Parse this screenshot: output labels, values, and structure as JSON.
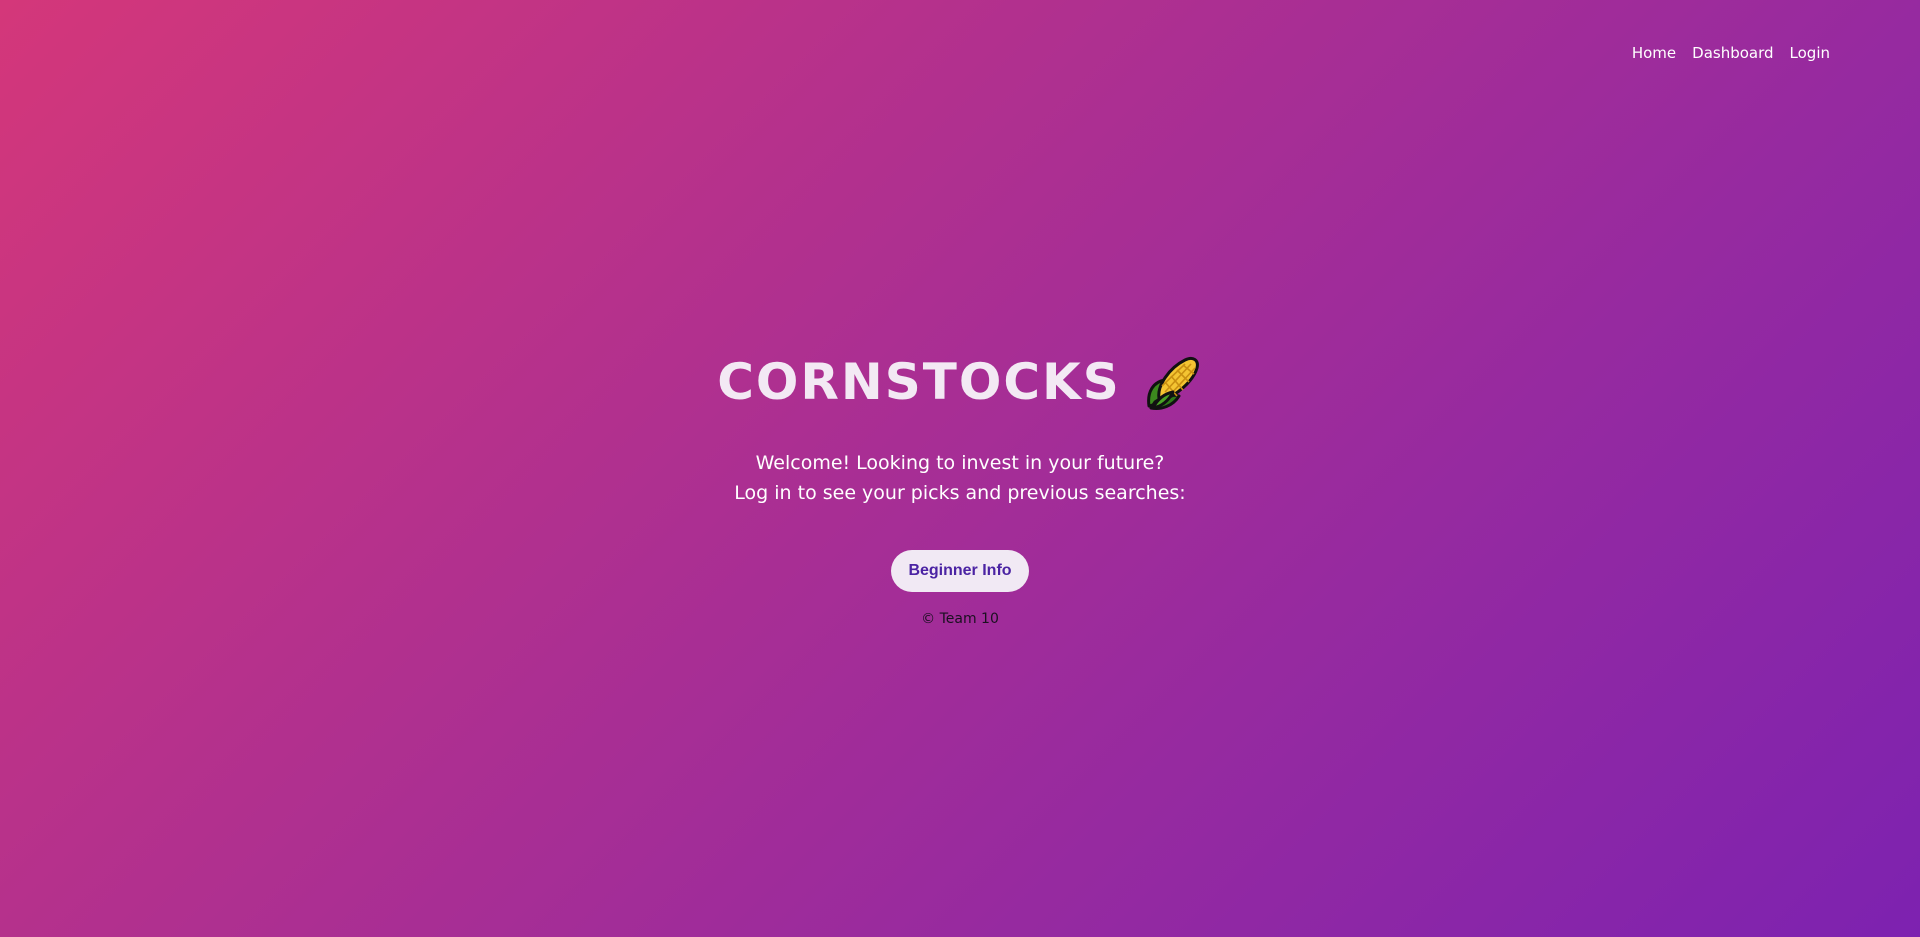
{
  "nav": {
    "items": [
      {
        "label": "Home"
      },
      {
        "label": "Dashboard"
      },
      {
        "label": "Login"
      }
    ]
  },
  "hero": {
    "title": "CORNSTOCKS",
    "icon": "corn-icon",
    "welcome_line1": "Welcome! Looking to invest in your future?",
    "welcome_line2": "Log in to see your picks and previous searches:",
    "button_label": "Beginner Info"
  },
  "footer": {
    "text": "© Team 10"
  },
  "colors": {
    "gradient_start": "#d4377a",
    "gradient_end": "#7d22b0",
    "button_bg": "#f1e9f4",
    "button_text": "#4b23a3"
  }
}
